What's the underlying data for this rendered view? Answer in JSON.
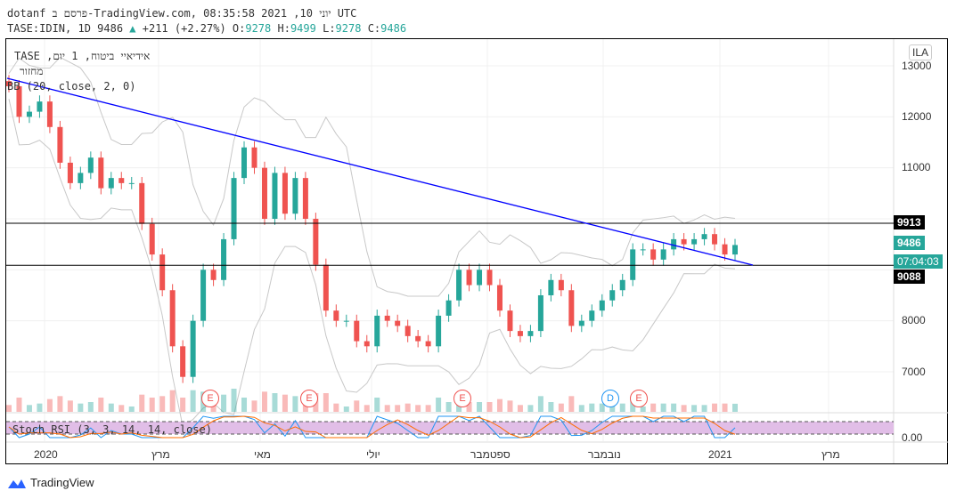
{
  "header": {
    "line1": "dotanf פרסם ב-TradingView.com, יוני 10, 2021 08:35:58 UTC",
    "symbol": "TASE:IDIN, 1D 9486",
    "change": "+211 (+2.27%)",
    "o_label": "O:",
    "o": "9278",
    "h_label": "H:",
    "h": "9499",
    "l_label": "L:",
    "l": "9278",
    "c_label": "C:",
    "c": "9486"
  },
  "legend": {
    "title": "אידיאיי ביטוח, 1 יום, TASE",
    "volume": "מחזור",
    "bb": "BB (20, close, 2, 0)",
    "stoch": "Stoch RSI (3, 3, 14, 14, close)"
  },
  "currency": "ILA",
  "price_axis": [
    "13000",
    "12000",
    "11000",
    "8000",
    "7000"
  ],
  "stoch_axis": "0.00",
  "tags": {
    "upper": "9913",
    "last": "9486",
    "countdown": "07:04:03",
    "lower": "9088"
  },
  "time_axis": [
    "2020",
    "מרץ",
    "מאי",
    "יולי",
    "ספטמבר",
    "נובמבר",
    "2021",
    "מרץ"
  ],
  "events": [
    {
      "label": "E",
      "color": "#ef5350"
    },
    {
      "label": "E",
      "color": "#ef5350"
    },
    {
      "label": "E",
      "color": "#ef5350"
    },
    {
      "label": "D",
      "color": "#2196f3"
    },
    {
      "label": "E",
      "color": "#ef5350"
    }
  ],
  "brand": "TradingView",
  "colors": {
    "up": "#26a69a",
    "down": "#ef5350",
    "trend": "#0000ff",
    "stoch_k": "#2196f3",
    "stoch_d": "#ff6d00",
    "stoch_band": "#e1bee7"
  },
  "chart_data": {
    "type": "candlestick",
    "ylim": [
      6500,
      13500
    ],
    "levels": {
      "resistance": 9913,
      "support": 9088
    },
    "trendline": {
      "start": 12756,
      "end": 9093
    },
    "closes": [
      12600,
      12000,
      12100,
      12300,
      11800,
      11100,
      10700,
      10900,
      11200,
      10600,
      10800,
      10700,
      10700,
      9900,
      9300,
      8600,
      7500,
      6900,
      8000,
      9000,
      8800,
      9600,
      10800,
      11400,
      11000,
      10000,
      10900,
      10100,
      10800,
      10000,
      9100,
      8200,
      8000,
      8000,
      7600,
      7500,
      8100,
      8000,
      7900,
      7700,
      7600,
      7500,
      8100,
      8400,
      9000,
      8700,
      9000,
      8700,
      8200,
      7800,
      7700,
      7800,
      8500,
      8800,
      8600,
      7900,
      8000,
      8200,
      8400,
      8600,
      8800,
      9400,
      9400,
      9200,
      9400,
      9600,
      9500,
      9600,
      9700,
      9500,
      9300,
      9486
    ]
  }
}
